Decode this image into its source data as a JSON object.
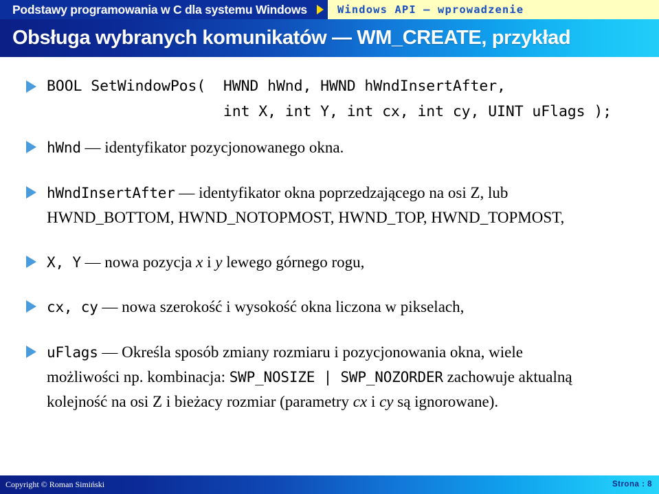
{
  "topbar": {
    "course_title": "Podstawy programowania w C dla systemu Windows",
    "section_title": "Windows API — wprowadzenie",
    "arrow_icon": "triangle-right-icon",
    "left_bg": "#0b2f9c",
    "right_bg": "#ffffc0",
    "arrow_color": "#ffd800",
    "section_text_color": "#1a4fbf"
  },
  "title": {
    "text": "Obsługa wybranych komunikatów — WM_CREATE, przykład",
    "gradient_start": "#0b1f86",
    "gradient_end": "#22cdf9"
  },
  "content": {
    "bullet_marker_icon": "triangle-right-bullet-icon",
    "bullet_color": "#4a9bdc",
    "bullets": [
      {
        "id": "signature",
        "kind": "code",
        "lines": [
          "BOOL SetWindowPos(  HWND hWnd, HWND hWndInsertAfter,",
          "                    int X, int Y, int cx, int cy, UINT uFlags );"
        ]
      },
      {
        "id": "hwnd",
        "kind": "text",
        "segments": [
          {
            "style": "mono",
            "text": "hWnd"
          },
          {
            "style": "serif",
            "text": " — identyfikator pozycjonowanego okna."
          }
        ]
      },
      {
        "id": "hwndinsertafter",
        "kind": "text",
        "segments": [
          {
            "style": "mono",
            "text": "hWndInsertAfter"
          },
          {
            "style": "serif",
            "text": " — identyfikator okna poprzedzającego na osi Z, lub"
          },
          {
            "style": "break",
            "text": ""
          },
          {
            "style": "serif",
            "text": "HWND_BOTTOM, HWND_NOTOPMOST, HWND_TOP, HWND_TOPMOST,"
          }
        ]
      },
      {
        "id": "x-y",
        "kind": "text",
        "segments": [
          {
            "style": "mono",
            "text": "X, Y"
          },
          {
            "style": "serif",
            "text": " — nowa pozycja "
          },
          {
            "style": "italic",
            "text": "x"
          },
          {
            "style": "serif",
            "text": " i "
          },
          {
            "style": "italic",
            "text": "y"
          },
          {
            "style": "serif",
            "text": " lewego górnego rogu,"
          }
        ]
      },
      {
        "id": "cx-cy",
        "kind": "text",
        "segments": [
          {
            "style": "mono",
            "text": "cx, cy"
          },
          {
            "style": "serif",
            "text": " — nowa szerokość i wysokość okna liczona w pikselach,"
          }
        ]
      },
      {
        "id": "uflags",
        "kind": "text",
        "segments": [
          {
            "style": "mono",
            "text": "uFlags"
          },
          {
            "style": "serif",
            "text": " — Określa sposób zmiany rozmiaru i pozycjonowania okna, wiele"
          },
          {
            "style": "break",
            "text": ""
          },
          {
            "style": "serif",
            "text": "możliwości np. kombinacja: "
          },
          {
            "style": "mono",
            "text": "SWP_NOSIZE | SWP_NOZORDER"
          },
          {
            "style": "serif",
            "text": " zachowuje aktualną"
          },
          {
            "style": "break",
            "text": ""
          },
          {
            "style": "serif",
            "text": "kolejność na osi Z i bieżacy rozmiar (parametry "
          },
          {
            "style": "italic",
            "text": "cx"
          },
          {
            "style": "serif",
            "text": " i "
          },
          {
            "style": "italic",
            "text": "cy"
          },
          {
            "style": "serif",
            "text": " są ignorowane)."
          }
        ]
      }
    ]
  },
  "footer": {
    "copyright": "Copyright © Roman Simiński",
    "page_label": "Strona :",
    "page_number": "8",
    "page_text": "Strona :  8"
  }
}
